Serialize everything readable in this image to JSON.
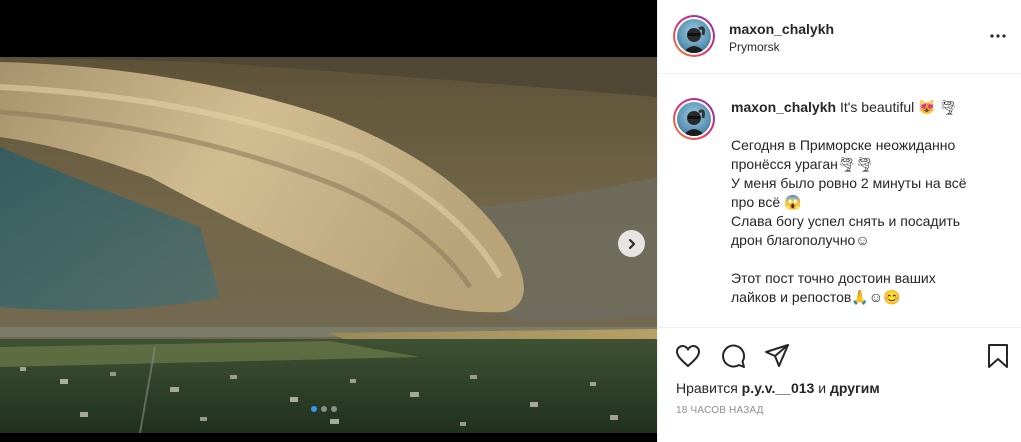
{
  "post": {
    "author": "maxon_chalykh",
    "location": "Prymorsk",
    "image_alt": "Shelf cloud over town",
    "carousel_dots": 3,
    "active_dot": 0
  },
  "caption": {
    "author": "maxon_chalykh",
    "first_line": "It's beautiful 😻 🌪",
    "lines": [
      "Сегодня в Приморске неожиданно",
      "пронёсся ураган🌪🌪",
      "У меня было ровно 2 минуты на всё",
      "про всё 😱",
      "Слава богу успел снять и посадить",
      "дрон благополучно☺",
      "",
      "Этот пост точно достоин ваших",
      "лайков и репостов🙏☺😊"
    ]
  },
  "engagement": {
    "likes_prefix": "Нравится",
    "likes_user": "p.y.v.__013",
    "likes_joiner": "и",
    "likes_others": "другим",
    "timestamp": "18 часов назад"
  },
  "icons": {
    "like": "heart-icon",
    "comment": "comment-icon",
    "share": "share-icon",
    "save": "bookmark-icon",
    "more": "more-icon",
    "next": "chevron-right-icon"
  },
  "colors": {
    "accent": "#3897f0",
    "text": "#262626",
    "muted": "#8e8e8e",
    "border": "#efefef"
  }
}
